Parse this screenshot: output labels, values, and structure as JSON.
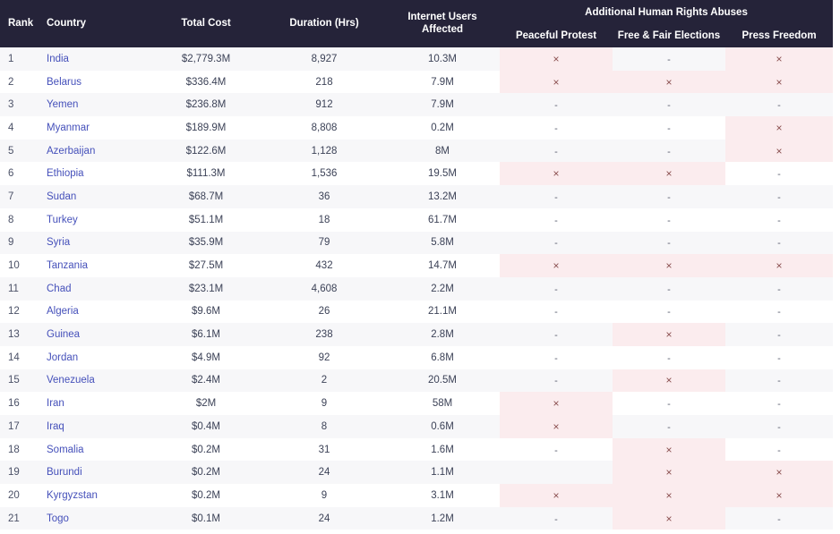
{
  "table": {
    "columns": {
      "rank": "Rank",
      "country": "Country",
      "total_cost": "Total Cost",
      "duration": "Duration (Hrs)",
      "users_line1": "Internet Users",
      "users_line2": "Affected",
      "group": "Additional Human Rights Abuses",
      "sub_peaceful_protest": "Peaceful Protest",
      "sub_free_fair_elections": "Free & Fair Elections",
      "sub_press_freedom": "Press Freedom"
    },
    "marks": {
      "x": "×",
      "dash": "-",
      "blank": ""
    },
    "colors": {
      "header_bg": "#252339",
      "header_text": "#ffffff",
      "row_odd_bg": "#f7f7f9",
      "row_even_bg": "#ffffff",
      "abuse_hit_bg": "#fbecee",
      "abuse_x": "#8a4f4f",
      "country_link": "#4550ba",
      "body_text": "#3c4257"
    },
    "rows": [
      {
        "rank": "1",
        "country": "India",
        "total_cost": "$2,779.3M",
        "duration": "8,927",
        "users": "10.3M",
        "peaceful_protest": "x",
        "free_fair_elections": "dash",
        "press_freedom": "x"
      },
      {
        "rank": "2",
        "country": "Belarus",
        "total_cost": "$336.4M",
        "duration": "218",
        "users": "7.9M",
        "peaceful_protest": "x",
        "free_fair_elections": "x",
        "press_freedom": "x"
      },
      {
        "rank": "3",
        "country": "Yemen",
        "total_cost": "$236.8M",
        "duration": "912",
        "users": "7.9M",
        "peaceful_protest": "dash",
        "free_fair_elections": "dash",
        "press_freedom": "dash"
      },
      {
        "rank": "4",
        "country": "Myanmar",
        "total_cost": "$189.9M",
        "duration": "8,808",
        "users": "0.2M",
        "peaceful_protest": "dash",
        "free_fair_elections": "dash",
        "press_freedom": "x"
      },
      {
        "rank": "5",
        "country": "Azerbaijan",
        "total_cost": "$122.6M",
        "duration": "1,128",
        "users": "8M",
        "peaceful_protest": "dash",
        "free_fair_elections": "dash",
        "press_freedom": "x"
      },
      {
        "rank": "6",
        "country": "Ethiopia",
        "total_cost": "$111.3M",
        "duration": "1,536",
        "users": "19.5M",
        "peaceful_protest": "x",
        "free_fair_elections": "x",
        "press_freedom": "dash"
      },
      {
        "rank": "7",
        "country": "Sudan",
        "total_cost": "$68.7M",
        "duration": "36",
        "users": "13.2M",
        "peaceful_protest": "dash",
        "free_fair_elections": "dash",
        "press_freedom": "dash"
      },
      {
        "rank": "8",
        "country": "Turkey",
        "total_cost": "$51.1M",
        "duration": "18",
        "users": "61.7M",
        "peaceful_protest": "dash",
        "free_fair_elections": "dash",
        "press_freedom": "dash"
      },
      {
        "rank": "9",
        "country": "Syria",
        "total_cost": "$35.9M",
        "duration": "79",
        "users": "5.8M",
        "peaceful_protest": "dash",
        "free_fair_elections": "dash",
        "press_freedom": "dash"
      },
      {
        "rank": "10",
        "country": "Tanzania",
        "total_cost": "$27.5M",
        "duration": "432",
        "users": "14.7M",
        "peaceful_protest": "x",
        "free_fair_elections": "x",
        "press_freedom": "x"
      },
      {
        "rank": "11",
        "country": "Chad",
        "total_cost": "$23.1M",
        "duration": "4,608",
        "users": "2.2M",
        "peaceful_protest": "dash",
        "free_fair_elections": "dash",
        "press_freedom": "dash"
      },
      {
        "rank": "12",
        "country": "Algeria",
        "total_cost": "$9.6M",
        "duration": "26",
        "users": "21.1M",
        "peaceful_protest": "dash",
        "free_fair_elections": "dash",
        "press_freedom": "dash"
      },
      {
        "rank": "13",
        "country": "Guinea",
        "total_cost": "$6.1M",
        "duration": "238",
        "users": "2.8M",
        "peaceful_protest": "dash",
        "free_fair_elections": "x",
        "press_freedom": "dash"
      },
      {
        "rank": "14",
        "country": "Jordan",
        "total_cost": "$4.9M",
        "duration": "92",
        "users": "6.8M",
        "peaceful_protest": "dash",
        "free_fair_elections": "dash",
        "press_freedom": "dash"
      },
      {
        "rank": "15",
        "country": "Venezuela",
        "total_cost": "$2.4M",
        "duration": "2",
        "users": "20.5M",
        "peaceful_protest": "dash",
        "free_fair_elections": "x",
        "press_freedom": "dash"
      },
      {
        "rank": "16",
        "country": "Iran",
        "total_cost": "$2M",
        "duration": "9",
        "users": "58M",
        "peaceful_protest": "x",
        "free_fair_elections": "dash",
        "press_freedom": "dash"
      },
      {
        "rank": "17",
        "country": "Iraq",
        "total_cost": "$0.4M",
        "duration": "8",
        "users": "0.6M",
        "peaceful_protest": "x",
        "free_fair_elections": "dash",
        "press_freedom": "dash"
      },
      {
        "rank": "18",
        "country": "Somalia",
        "total_cost": "$0.2M",
        "duration": "31",
        "users": "1.6M",
        "peaceful_protest": "dash",
        "free_fair_elections": "x",
        "press_freedom": "dash"
      },
      {
        "rank": "19",
        "country": "Burundi",
        "total_cost": "$0.2M",
        "duration": "24",
        "users": "1.1M",
        "peaceful_protest": "blank",
        "free_fair_elections": "x",
        "press_freedom": "x"
      },
      {
        "rank": "20",
        "country": "Kyrgyzstan",
        "total_cost": "$0.2M",
        "duration": "9",
        "users": "3.1M",
        "peaceful_protest": "x",
        "free_fair_elections": "x",
        "press_freedom": "x"
      },
      {
        "rank": "21",
        "country": "Togo",
        "total_cost": "$0.1M",
        "duration": "24",
        "users": "1.2M",
        "peaceful_protest": "dash",
        "free_fair_elections": "x",
        "press_freedom": "dash"
      }
    ]
  }
}
